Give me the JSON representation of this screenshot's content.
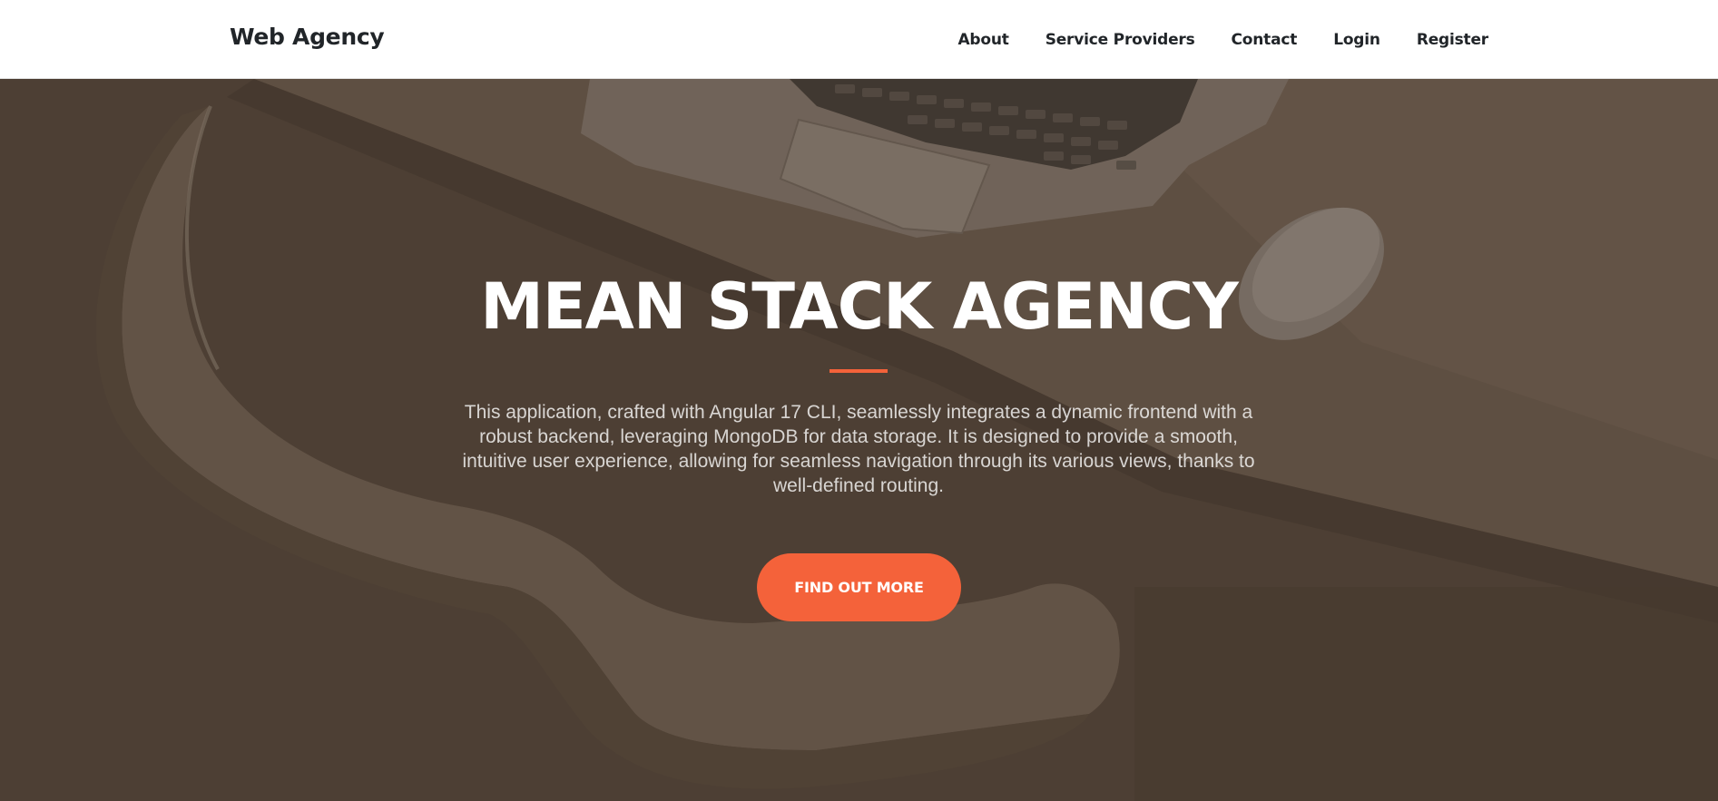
{
  "navbar": {
    "brand": "Web Agency",
    "links": [
      {
        "label": "About"
      },
      {
        "label": "Service Providers"
      },
      {
        "label": "Contact"
      },
      {
        "label": "Login"
      },
      {
        "label": "Register"
      }
    ]
  },
  "hero": {
    "title": "MEAN STACK AGENCY",
    "description": "This application, crafted with Angular 17 CLI, seamlessly integrates a dynamic frontend with a robust backend, leveraging MongoDB for data storage. It is designed to provide a smooth, intuitive user experience, allowing for seamless navigation through its various views, thanks to well-defined routing.",
    "cta_label": "FIND OUT MORE",
    "background_image": "laptop-chair-desk-photo"
  },
  "colors": {
    "accent": "#f4623a",
    "overlay": "#4d4036",
    "nav_text": "#212529"
  }
}
